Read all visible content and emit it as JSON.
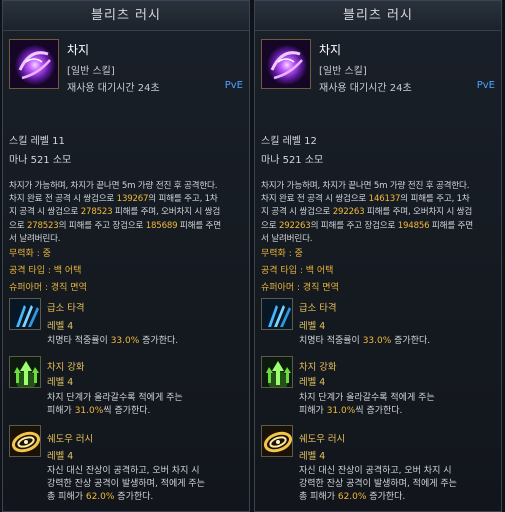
{
  "colors": {
    "accent_gold": "#f0b93a",
    "pve_blue": "#4da3ff",
    "text": "#cfd3d8"
  },
  "tooltips": [
    {
      "title": "블리츠 러시",
      "skill_name": "차지",
      "skill_type": "[일반 스킬]",
      "cooldown": "재사용 대기시간 24초",
      "pve_tag": "PvE",
      "skill_level": "스킬 레벨 11",
      "mana_cost": "마나 521 소모",
      "description": {
        "l1": "차지가 가능하며, 차지가 끝나면 5m 가량 전진 후 공격한다.",
        "l2a": "차지 완료 전 공격 시 쌍검으로 ",
        "n1": "139267",
        "l2b": "의 피해를 주고, 1차",
        "l3a": "지 공격 시 쌍검으로 ",
        "n2": "278523",
        "l3b": " 피해를 주며, 오버차지 시 쌍검",
        "l4a": "으로 ",
        "n3": "278523",
        "l4b": "의 피해를 주고 장검으로 ",
        "n4": "185689",
        "l4c": " 피해를 주면",
        "l5": "서 날려버린다."
      },
      "stats": [
        {
          "label": "무력화 : ",
          "value": "중"
        },
        {
          "label": "공격 타입 : ",
          "value": "백 어택"
        },
        {
          "label": "슈퍼아머 : ",
          "value": "경직 면역"
        }
      ],
      "tripods": [
        {
          "icon": "claw-slash-icon",
          "name": "급소 타격",
          "level": "레벨 4",
          "desc_a": "치명타 적중률이 ",
          "pct": "33.0%",
          "desc_b": " 증가한다.",
          "desc_c": ""
        },
        {
          "icon": "green-arrows-up-icon",
          "name": "차지 강화",
          "level": "레벨 4",
          "desc_a": "차지 단계가 올라갈수록 적에게 주는",
          "desc_b": "피해가 ",
          "pct": "31.0%",
          "desc_c": "씩 증가한다."
        },
        {
          "icon": "golden-swirl-icon",
          "name": "쉐도우 러시",
          "level": "레벨 4",
          "desc_a": "자신 대신 잔상이 공격하고, 오버 차지 시",
          "desc_b": "강력한 잔상 공격이 발생하며, 적에게 주는",
          "desc_c": "총 피해가 ",
          "pct": "62.0%",
          "desc_d": " 증가한다."
        }
      ]
    },
    {
      "title": "블리츠 러시",
      "skill_name": "차지",
      "skill_type": "[일반 스킬]",
      "cooldown": "재사용 대기시간 24초",
      "pve_tag": "PvE",
      "skill_level": "스킬 레벨 12",
      "mana_cost": "마나 521 소모",
      "description": {
        "l1": "차지가 가능하며, 차지가 끝나면 5m 가량 전진 후 공격한다.",
        "l2a": "차지 완료 전 공격 시 쌍검으로 ",
        "n1": "146137",
        "l2b": "의 피해를 주고, 1차",
        "l3a": "지 공격 시 쌍검으로 ",
        "n2": "292263",
        "l3b": " 피해를 주며, 오버차지 시 쌍검",
        "l4a": "으로 ",
        "n3": "292263",
        "l4b": "의 피해를 주고 장검으로 ",
        "n4": "194856",
        "l4c": " 피해를 주면",
        "l5": "서 날려버린다."
      },
      "stats": [
        {
          "label": "무력화 : ",
          "value": "중"
        },
        {
          "label": "공격 타입 : ",
          "value": "백 어택"
        },
        {
          "label": "슈퍼아머 : ",
          "value": "경직 면역"
        }
      ],
      "tripods": [
        {
          "icon": "claw-slash-icon",
          "name": "급소 타격",
          "level": "레벨 4",
          "desc_a": "치명타 적중률이 ",
          "pct": "33.0%",
          "desc_b": " 증가한다.",
          "desc_c": ""
        },
        {
          "icon": "green-arrows-up-icon",
          "name": "차지 강화",
          "level": "레벨 4",
          "desc_a": "차지 단계가 올라갈수록 적에게 주는",
          "desc_b": "피해가 ",
          "pct": "31.0%",
          "desc_c": "씩 증가한다."
        },
        {
          "icon": "golden-swirl-icon",
          "name": "쉐도우 러시",
          "level": "레벨 4",
          "desc_a": "자신 대신 잔상이 공격하고, 오버 차지 시",
          "desc_b": "강력한 잔상 공격이 발생하며, 적에게 주는",
          "desc_c": "총 피해가 ",
          "pct": "62.0%",
          "desc_d": " 증가한다."
        }
      ]
    }
  ]
}
